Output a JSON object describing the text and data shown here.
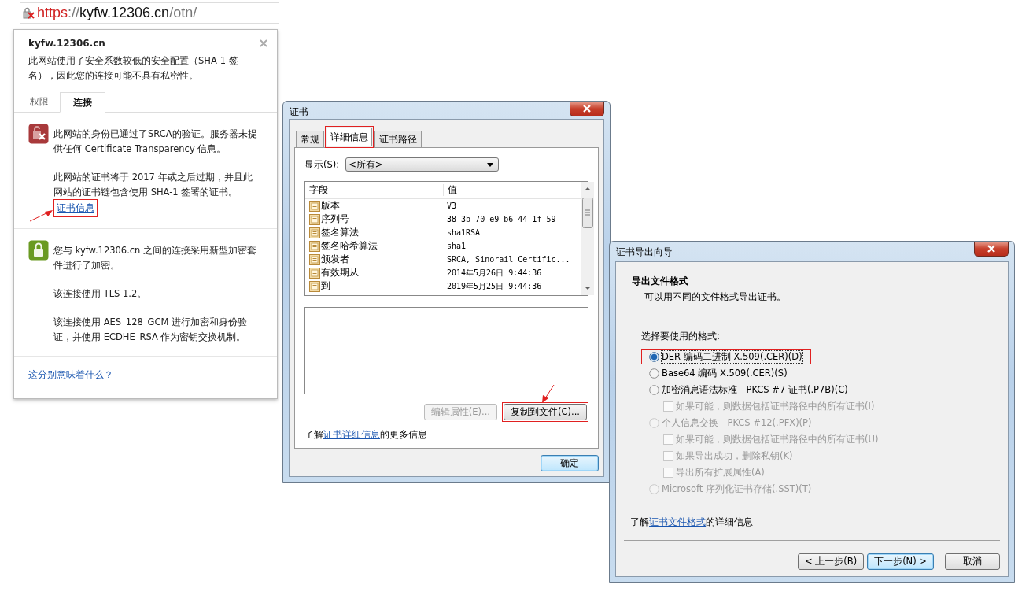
{
  "address_bar": {
    "insecure": true,
    "parts": [
      {
        "kind": "scheme",
        "text": "https"
      },
      {
        "kind": "dim",
        "text": "://"
      },
      {
        "kind": "host",
        "text": "kyfw.12306.cn"
      },
      {
        "kind": "dim",
        "text": "/otn/"
      }
    ]
  },
  "site_info": {
    "title": "kyfw.12306.cn",
    "warning": "此网站使用了安全系数较低的安全配置（SHA-1 签名），因此您的连接可能不具有私密性。",
    "tabs": [
      {
        "label": "权限",
        "selected": false
      },
      {
        "label": "连接",
        "selected": true
      }
    ],
    "sections": [
      {
        "kind": "error",
        "paragraphs": [
          "此网站的身份已通过了SRCA的验证。服务器未提供任何 Certificate Transparency 信息。",
          "此网站的证书将于 2017 年或之后过期，并且此网站的证书链包含使用 SHA-1 签署的证书。"
        ],
        "link": {
          "text": "证书信息",
          "highlighted": true,
          "arrow": true
        }
      },
      {
        "kind": "secure",
        "paragraphs": [
          "您与 kyfw.12306.cn 之间的连接采用新型加密套件进行了加密。",
          "该连接使用 TLS 1.2。",
          "该连接使用 AES_128_GCM 进行加密和身份验证，并使用 ECDHE_RSA 作为密钥交换机制。"
        ]
      }
    ],
    "footer_link": "这分别意味着什么？"
  },
  "certificate_dialog": {
    "title": "证书",
    "tabs": [
      {
        "label": "常规",
        "selected": false,
        "highlighted": false
      },
      {
        "label": "详细信息",
        "selected": true,
        "highlighted": true
      },
      {
        "label": "证书路径",
        "selected": false,
        "highlighted": false
      }
    ],
    "show_label": "显示(S):",
    "show_value": "<所有>",
    "columns": [
      "字段",
      "值"
    ],
    "rows": [
      {
        "field": "版本",
        "value": "V3",
        "selected": false
      },
      {
        "field": "序列号",
        "value": "38 3b 70 e9 b6 44 1f 59",
        "selected": false
      },
      {
        "field": "签名算法",
        "value": "sha1RSA",
        "selected": false
      },
      {
        "field": "签名哈希算法",
        "value": "sha1",
        "selected": false
      },
      {
        "field": "颁发者",
        "value": "SRCA, Sinorail Certific...",
        "selected": false
      },
      {
        "field": "有效期从",
        "value": "2014年5月26日 9:44:36",
        "selected": false
      },
      {
        "field": "到",
        "value": "2019年5月25日 9:44:36",
        "selected": false
      }
    ],
    "buttons": [
      {
        "label": "编辑属性(E)...",
        "disabled": true,
        "highlighted": false,
        "arrow": false
      },
      {
        "label": "复制到文件(C)...",
        "disabled": false,
        "highlighted": true,
        "arrow": true
      }
    ],
    "info": {
      "before": "了解",
      "link": "证书详细信息",
      "after": "的更多信息"
    },
    "ok_button": "确定"
  },
  "export_wizard": {
    "title": "证书导出向导",
    "heading": "导出文件格式",
    "subheading": "可以用不同的文件格式导出证书。",
    "prompt": "选择要使用的格式:",
    "options": [
      {
        "label": "DER 编码二进制 X.509(.CER)(D)",
        "selected": true,
        "disabled": false,
        "highlighted": true
      },
      {
        "label": "Base64 编码 X.509(.CER)(S)",
        "selected": false,
        "disabled": false,
        "highlighted": false
      },
      {
        "label": "加密消息语法标准 - PKCS #7 证书(.P7B)(C)",
        "selected": false,
        "disabled": false,
        "highlighted": false,
        "children": [
          {
            "label": "如果可能，则数据包括证书路径中的所有证书(I)",
            "checked": false,
            "disabled": true
          }
        ]
      },
      {
        "label": "个人信息交换 - PKCS #12(.PFX)(P)",
        "selected": false,
        "disabled": true,
        "highlighted": false,
        "children": [
          {
            "label": "如果可能，则数据包括证书路径中的所有证书(U)",
            "checked": false,
            "disabled": true
          },
          {
            "label": "如果导出成功，删除私钥(K)",
            "checked": false,
            "disabled": true
          },
          {
            "label": "导出所有扩展属性(A)",
            "checked": false,
            "disabled": true
          }
        ]
      },
      {
        "label": "Microsoft 序列化证书存储(.SST)(T)",
        "selected": false,
        "disabled": true,
        "highlighted": false
      }
    ],
    "info": {
      "before": "了解",
      "link": "证书文件格式",
      "after": "的详细信息"
    },
    "buttons": [
      {
        "label": "< 上一步(B)",
        "default": false
      },
      {
        "label": "下一步(N) >",
        "default": true
      },
      {
        "label": "取消",
        "default": false
      }
    ]
  }
}
